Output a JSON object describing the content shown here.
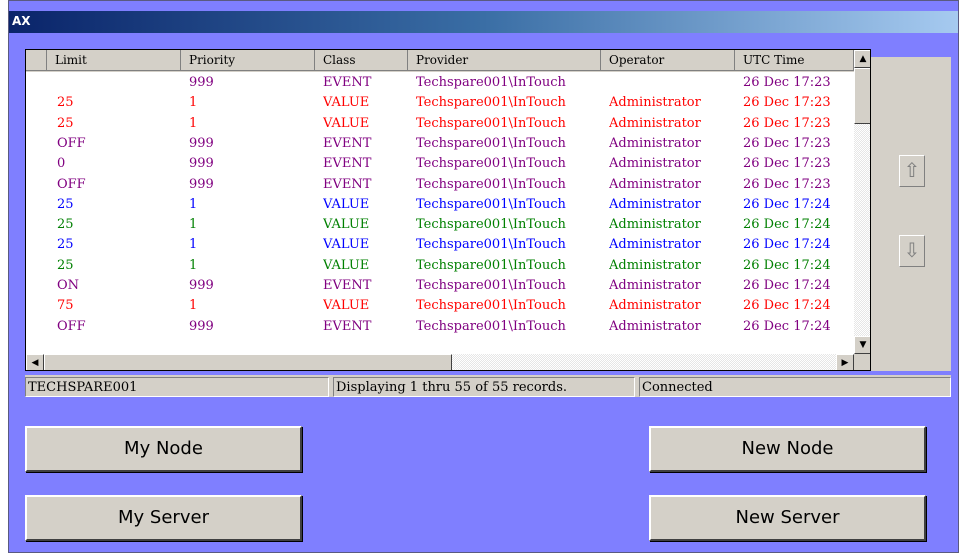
{
  "window": {
    "title": "AX"
  },
  "grid": {
    "columns": [
      "Limit",
      "Priority",
      "Class",
      "Provider",
      "Operator",
      "UTC Time"
    ],
    "rows": [
      {
        "limit": "",
        "priority": "999",
        "class": "EVENT",
        "provider": "Techspare001\\InTouch",
        "operator": "",
        "time": "26 Dec 17:23",
        "color": "#800080"
      },
      {
        "limit": "25",
        "priority": "1",
        "class": "VALUE",
        "provider": "Techspare001\\InTouch",
        "operator": "Administrator",
        "time": "26 Dec 17:23",
        "color": "#ff0000"
      },
      {
        "limit": "25",
        "priority": "1",
        "class": "VALUE",
        "provider": "Techspare001\\InTouch",
        "operator": "Administrator",
        "time": "26 Dec 17:23",
        "color": "#ff0000"
      },
      {
        "limit": "OFF",
        "priority": "999",
        "class": "EVENT",
        "provider": "Techspare001\\InTouch",
        "operator": "Administrator",
        "time": "26 Dec 17:23",
        "color": "#800080"
      },
      {
        "limit": "0",
        "priority": "999",
        "class": "EVENT",
        "provider": "Techspare001\\InTouch",
        "operator": "Administrator",
        "time": "26 Dec 17:23",
        "color": "#800080"
      },
      {
        "limit": "OFF",
        "priority": "999",
        "class": "EVENT",
        "provider": "Techspare001\\InTouch",
        "operator": "Administrator",
        "time": "26 Dec 17:23",
        "color": "#800080"
      },
      {
        "limit": "25",
        "priority": "1",
        "class": "VALUE",
        "provider": "Techspare001\\InTouch",
        "operator": "Administrator",
        "time": "26 Dec 17:24",
        "color": "#0000ff"
      },
      {
        "limit": "25",
        "priority": "1",
        "class": "VALUE",
        "provider": "Techspare001\\InTouch",
        "operator": "Administrator",
        "time": "26 Dec 17:24",
        "color": "#008000"
      },
      {
        "limit": "25",
        "priority": "1",
        "class": "VALUE",
        "provider": "Techspare001\\InTouch",
        "operator": "Administrator",
        "time": "26 Dec 17:24",
        "color": "#0000ff"
      },
      {
        "limit": "25",
        "priority": "1",
        "class": "VALUE",
        "provider": "Techspare001\\InTouch",
        "operator": "Administrator",
        "time": "26 Dec 17:24",
        "color": "#008000"
      },
      {
        "limit": "ON",
        "priority": "999",
        "class": "EVENT",
        "provider": "Techspare001\\InTouch",
        "operator": "Administrator",
        "time": "26 Dec 17:24",
        "color": "#800080"
      },
      {
        "limit": "75",
        "priority": "1",
        "class": "VALUE",
        "provider": "Techspare001\\InTouch",
        "operator": "Administrator",
        "time": "26 Dec 17:24",
        "color": "#ff0000"
      },
      {
        "limit": "OFF",
        "priority": "999",
        "class": "EVENT",
        "provider": "Techspare001\\InTouch",
        "operator": "Administrator",
        "time": "26 Dec 17:24",
        "color": "#800080"
      }
    ]
  },
  "scroll_icons": {
    "up": "triangle-up-icon",
    "down": "triangle-down-icon",
    "left": "triangle-left-icon",
    "right": "triangle-right-icon"
  },
  "side": {
    "up_glyph": "⇧",
    "down_glyph": "⇩",
    "up_icon": "arrow-up-icon",
    "down_icon": "arrow-down-icon"
  },
  "status": {
    "node": "TECHSPARE001",
    "records": "Displaying 1 thru 55 of 55 records.",
    "connection": "Connected"
  },
  "buttons": {
    "my_node": "My Node",
    "my_server": "My Server",
    "new_node": "New Node",
    "new_server": "New Server"
  },
  "colors": {
    "window_bg": "#7f7fff",
    "chrome": "#d4d0c8",
    "title_start": "#0a246a"
  }
}
